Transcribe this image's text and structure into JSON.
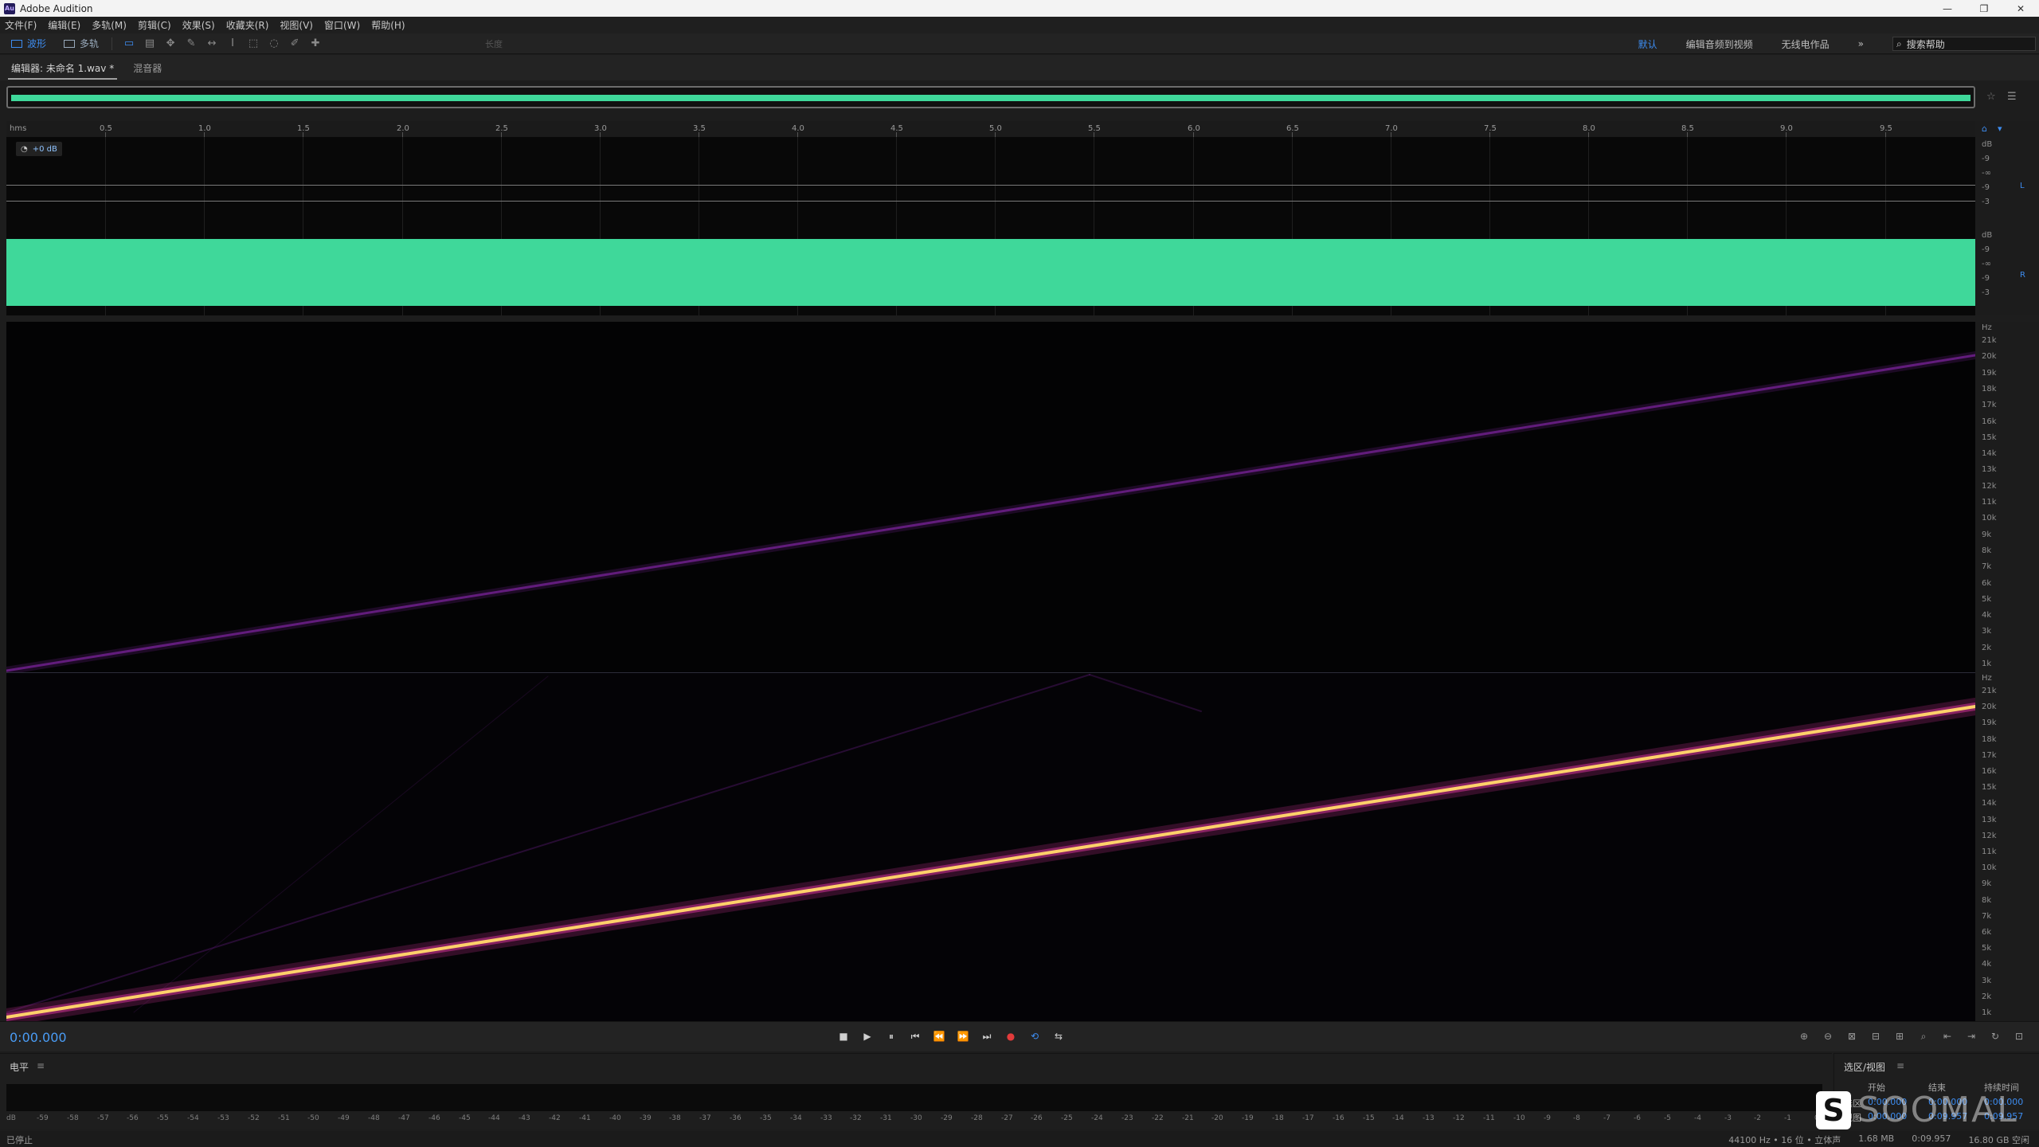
{
  "window": {
    "title": "Adobe Audition",
    "logo_text": "Au",
    "controls": [
      "—",
      "❐",
      "✕"
    ]
  },
  "menu": [
    "文件(F)",
    "编辑(E)",
    "多轨(M)",
    "剪辑(C)",
    "效果(S)",
    "收藏夹(R)",
    "视图(V)",
    "窗口(W)",
    "帮助(H)"
  ],
  "toolbar": {
    "mode_waveform": "波形",
    "mode_multitrack": "多轨",
    "extra_label": "长度",
    "workspaces": [
      "默认",
      "编辑音频到视频",
      "无线电作品"
    ],
    "more": "»",
    "search_placeholder": "搜索帮助"
  },
  "tabs": {
    "editor": "编辑器: 未命名 1.wav *",
    "mixer": "混音器"
  },
  "ruler": {
    "unit": "hms",
    "ticks": [
      "0.5",
      "1.0",
      "1.5",
      "2.0",
      "2.5",
      "3.0",
      "3.5",
      "4.0",
      "4.5",
      "5.0",
      "5.5",
      "6.0",
      "6.5",
      "7.0",
      "7.5",
      "8.0",
      "8.5",
      "9.0",
      "9.5"
    ]
  },
  "waveform": {
    "gain": "+0 dB",
    "db_label": "dB",
    "scale_L": [
      "dB",
      "-9",
      "-∞",
      "-9",
      "-3"
    ],
    "scale_R": [
      "dB",
      "-9",
      "-∞",
      "-9",
      "-3"
    ],
    "channel_L": "L",
    "channel_R": "R",
    "colors": {
      "wave": "#3fd89a",
      "background": "#080808"
    }
  },
  "spectrogram": {
    "hz_label": "Hz",
    "freq_labels": [
      "21k",
      "20k",
      "19k",
      "18k",
      "17k",
      "16k",
      "15k",
      "14k",
      "13k",
      "12k",
      "11k",
      "10k",
      "9k",
      "8k",
      "7k",
      "6k",
      "5k",
      "4k",
      "3k",
      "2k",
      "1k"
    ],
    "colors": {
      "sweep_dim": "#6a1f86",
      "sweep_core": "#ffd16a",
      "sweep_glow": "#c0308a"
    }
  },
  "transport": {
    "time": "0:00.000",
    "buttons": [
      "■",
      "▶",
      "⏸",
      "⏮",
      "⏪",
      "⏩",
      "⏭",
      "●",
      "⟲",
      "⇆"
    ],
    "zoom": [
      "⊕",
      "⊖",
      "⊠",
      "⊟",
      "⊞",
      "⌕",
      "⇤",
      "⇥",
      "↻",
      "⊡"
    ]
  },
  "levels": {
    "title": "电平",
    "scale": [
      "dB",
      "-59",
      "-58",
      "-57",
      "-56",
      "-55",
      "-54",
      "-53",
      "-52",
      "-51",
      "-50",
      "-49",
      "-48",
      "-47",
      "-46",
      "-45",
      "-44",
      "-43",
      "-42",
      "-41",
      "-40",
      "-39",
      "-38",
      "-37",
      "-36",
      "-35",
      "-34",
      "-33",
      "-32",
      "-31",
      "-30",
      "-29",
      "-28",
      "-27",
      "-26",
      "-25",
      "-24",
      "-23",
      "-22",
      "-21",
      "-20",
      "-19",
      "-18",
      "-17",
      "-16",
      "-15",
      "-14",
      "-13",
      "-12",
      "-11",
      "-10",
      "-9",
      "-8",
      "-7",
      "-6",
      "-5",
      "-4",
      "-3",
      "-2",
      "-1",
      "0"
    ]
  },
  "selection_view": {
    "title": "选区/视图",
    "headers": [
      "开始",
      "结束",
      "持续时间"
    ],
    "rows": [
      {
        "label": "选区",
        "start": "0:00.000",
        "end": "0:00.000",
        "duration": "0:00.000"
      },
      {
        "label": "视图",
        "start": "0:00.000",
        "end": "0:09.957",
        "duration": "0:09.957"
      }
    ]
  },
  "status": {
    "left": "已停止",
    "items": [
      "44100 Hz • 16 位 • 立体声",
      "1.68 MB",
      "0:09.957",
      "16.80 GB 空闲"
    ]
  },
  "watermark": {
    "logo": "S",
    "text": "SOOMAL"
  }
}
